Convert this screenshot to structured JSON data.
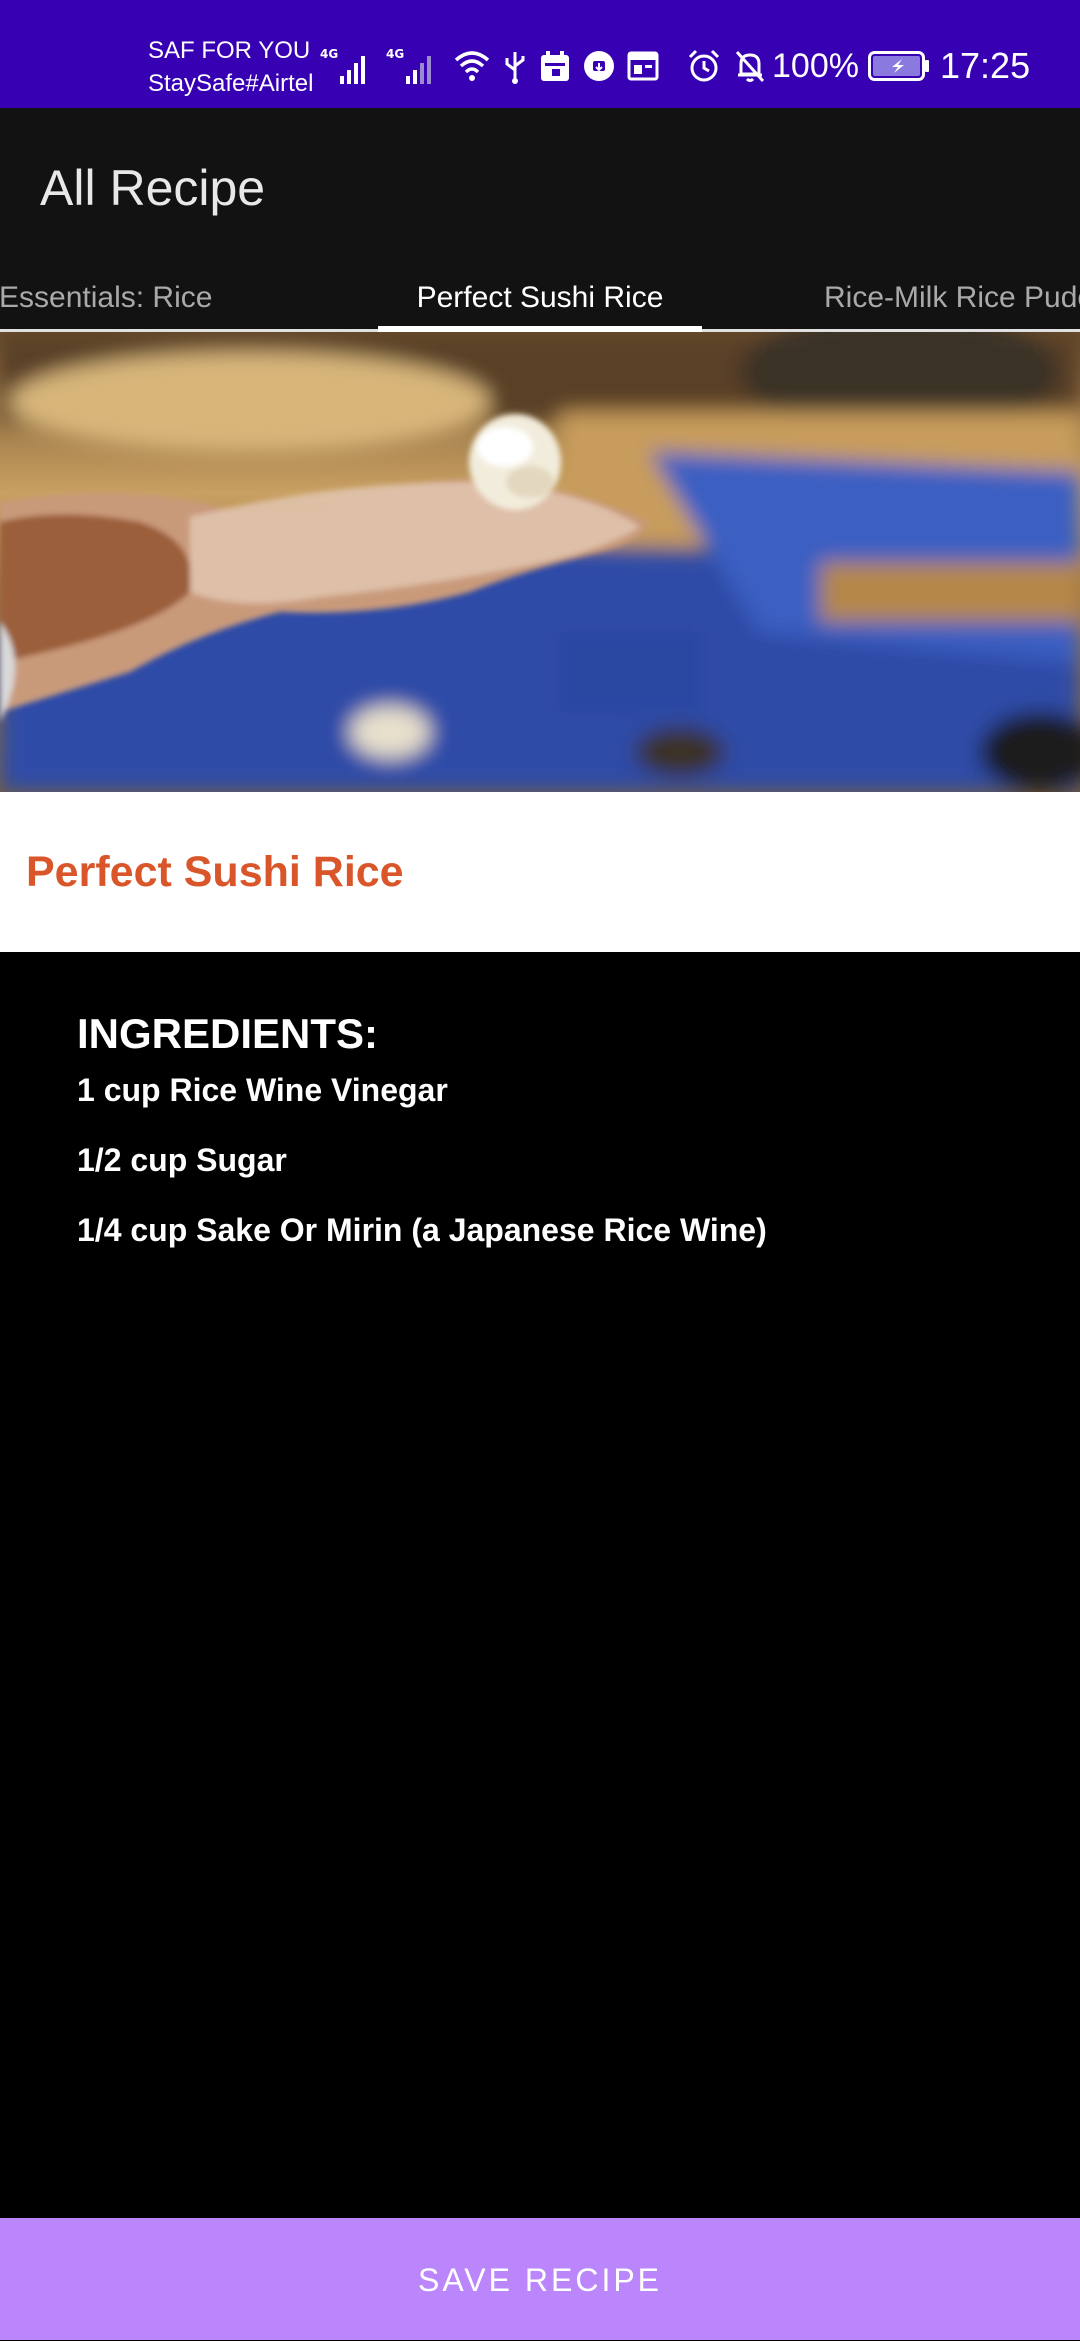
{
  "status_bar": {
    "carrier_line1": "SAF FOR YOU",
    "carrier_line2": "StaySafe#Airtel",
    "battery_percent": "100%",
    "time": "17:25",
    "icons": [
      "signal-4g-icon",
      "signal-4g-icon",
      "wifi-icon",
      "usb-icon",
      "calendar-icon",
      "download-icon",
      "app-icon",
      "alarm-icon",
      "mute-bell-icon",
      "battery-charging-icon"
    ],
    "color": "#3700B3"
  },
  "app_bar": {
    "title": "All Recipe"
  },
  "tabs": [
    {
      "label": "Essentials: Rice",
      "selected": false
    },
    {
      "label": "Perfect Sushi Rice",
      "selected": true
    },
    {
      "label": "Rice-Milk Rice Pudc",
      "selected": false
    }
  ],
  "recipe": {
    "title": "Perfect Sushi Rice",
    "title_color": "#d9562a",
    "ingredients_heading": "INGREDIENTS:",
    "ingredients": [
      "1 cup Rice Wine Vinegar",
      "1/2 cup Sugar",
      "1/4 cup Sake Or Mirin (a Japanese Rice Wine)"
    ]
  },
  "actions": {
    "save_label": "SAVE RECIPE",
    "save_color": "#BB86FC"
  }
}
